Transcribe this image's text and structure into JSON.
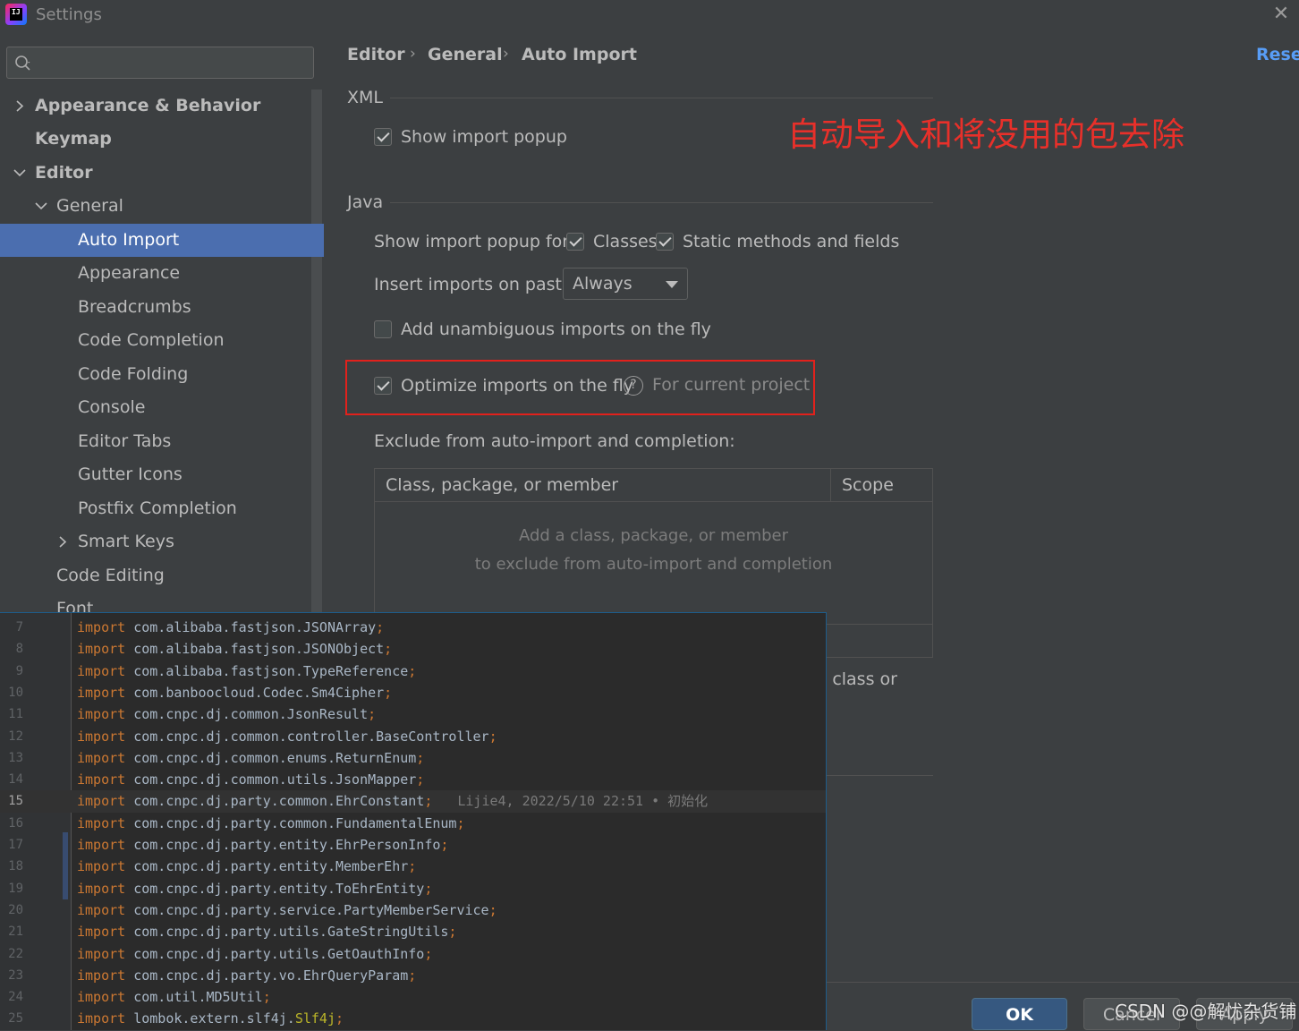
{
  "window": {
    "title": "Settings",
    "logo_text": "IJ"
  },
  "sidebar": {
    "search_placeholder": "",
    "items": [
      {
        "label": "Appearance & Behavior"
      },
      {
        "label": "Keymap"
      },
      {
        "label": "Editor"
      },
      {
        "label": "General"
      },
      {
        "label": "Auto Import"
      },
      {
        "label": "Appearance"
      },
      {
        "label": "Breadcrumbs"
      },
      {
        "label": "Code Completion"
      },
      {
        "label": "Code Folding"
      },
      {
        "label": "Console"
      },
      {
        "label": "Editor Tabs"
      },
      {
        "label": "Gutter Icons"
      },
      {
        "label": "Postfix Completion"
      },
      {
        "label": "Smart Keys"
      },
      {
        "label": "Code Editing"
      },
      {
        "label": "Font"
      }
    ]
  },
  "breadcrumb": {
    "items": [
      "Editor",
      "General",
      "Auto Import"
    ],
    "reset": "Reset"
  },
  "xml": {
    "title": "XML",
    "show_import_popup": "Show import popup"
  },
  "annotation": "自动导入和将没用的包去除",
  "java": {
    "title": "Java",
    "popup_for_label": "Show import popup for:",
    "classes": "Classes",
    "static_methods": "Static methods and fields",
    "paste_label": "Insert imports on paste:",
    "paste_value": "Always",
    "unambiguous": "Add unambiguous imports on the fly",
    "optimize": "Optimize imports on the fly",
    "optimize_hint": "For current project",
    "exclude_label": "Exclude from auto-import and completion:",
    "table": {
      "col1": "Class, package, or member",
      "col2": "Scope",
      "empty_line1": "Add a class, package, or member",
      "empty_line2": "to exclude from auto-import and completion"
    },
    "partial_text": "l class or"
  },
  "buttons": {
    "ok": "OK",
    "cancel": "Cancel",
    "apply": "Apply"
  },
  "watermark": "CSDN @@解忧杂货铺",
  "code": {
    "lines": [
      {
        "n": "7",
        "kw": "import",
        "pkg": " com.alibaba.fastjson.JSONArray",
        "semi": ";"
      },
      {
        "n": "8",
        "kw": "import",
        "pkg": " com.alibaba.fastjson.JSONObject",
        "semi": ";"
      },
      {
        "n": "9",
        "kw": "import",
        "pkg": " com.alibaba.fastjson.TypeReference",
        "semi": ";"
      },
      {
        "n": "10",
        "kw": "import",
        "pkg": " com.banboocloud.Codec.Sm4Cipher",
        "semi": ";"
      },
      {
        "n": "11",
        "kw": "import",
        "pkg": " com.cnpc.dj.common.JsonResult",
        "semi": ";"
      },
      {
        "n": "12",
        "kw": "import",
        "pkg": " com.cnpc.dj.common.controller.BaseController",
        "semi": ";"
      },
      {
        "n": "13",
        "kw": "import",
        "pkg": " com.cnpc.dj.common.enums.ReturnEnum",
        "semi": ";"
      },
      {
        "n": "14",
        "kw": "import",
        "pkg": " com.cnpc.dj.common.utils.JsonMapper",
        "semi": ";"
      },
      {
        "n": "15",
        "kw": "import",
        "pkg": " com.cnpc.dj.party.common.EhrConstant",
        "semi": ";",
        "blame": "Lijie4, 2022/5/10 22:51 • 初始化"
      },
      {
        "n": "16",
        "kw": "import",
        "pkg": " com.cnpc.dj.party.common.FundamentalEnum",
        "semi": ";"
      },
      {
        "n": "17",
        "kw": "import",
        "pkg": " com.cnpc.dj.party.entity.EhrPersonInfo",
        "semi": ";"
      },
      {
        "n": "18",
        "kw": "import",
        "pkg": " com.cnpc.dj.party.entity.MemberEhr",
        "semi": ";"
      },
      {
        "n": "19",
        "kw": "import",
        "pkg": " com.cnpc.dj.party.entity.ToEhrEntity",
        "semi": ";"
      },
      {
        "n": "20",
        "kw": "import",
        "pkg": " com.cnpc.dj.party.service.PartyMemberService",
        "semi": ";"
      },
      {
        "n": "21",
        "kw": "import",
        "pkg": " com.cnpc.dj.party.utils.GateStringUtils",
        "semi": ";"
      },
      {
        "n": "22",
        "kw": "import",
        "pkg": " com.cnpc.dj.party.utils.GetOauthInfo",
        "semi": ";"
      },
      {
        "n": "23",
        "kw": "import",
        "pkg": " com.cnpc.dj.party.vo.EhrQueryParam",
        "semi": ";"
      },
      {
        "n": "24",
        "kw": "import",
        "pkg": " com.util.MD5Util",
        "semi": ";"
      },
      {
        "n": "25",
        "kw": "import",
        "pkg": " lombok.extern.slf4j.",
        "cls": "Slf4j",
        "semi": ";"
      }
    ]
  }
}
